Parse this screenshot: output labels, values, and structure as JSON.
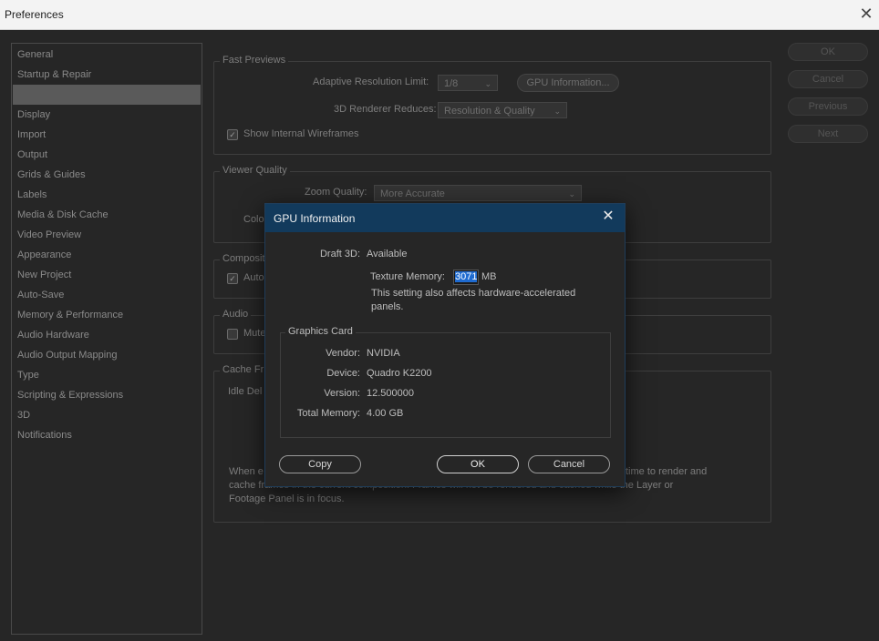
{
  "window": {
    "title": "Preferences"
  },
  "sidebar": {
    "items": [
      {
        "label": "General"
      },
      {
        "label": "Startup & Repair"
      },
      {
        "label": ""
      },
      {
        "label": "Display"
      },
      {
        "label": "Import"
      },
      {
        "label": "Output"
      },
      {
        "label": "Grids & Guides"
      },
      {
        "label": "Labels"
      },
      {
        "label": "Media & Disk Cache"
      },
      {
        "label": "Video Preview"
      },
      {
        "label": "Appearance"
      },
      {
        "label": "New Project"
      },
      {
        "label": "Auto-Save"
      },
      {
        "label": "Memory & Performance"
      },
      {
        "label": "Audio Hardware"
      },
      {
        "label": "Audio Output Mapping"
      },
      {
        "label": "Type"
      },
      {
        "label": "Scripting & Expressions"
      },
      {
        "label": "3D"
      },
      {
        "label": "Notifications"
      }
    ]
  },
  "right_buttons": {
    "ok": "OK",
    "cancel": "Cancel",
    "previous": "Previous",
    "next": "Next"
  },
  "fast_previews": {
    "title": "Fast Previews",
    "adaptive_label": "Adaptive Resolution Limit:",
    "adaptive_value": "1/8",
    "gpu_info_button": "GPU Information...",
    "renderer_label": "3D Renderer Reduces:",
    "renderer_value": "Resolution & Quality",
    "wireframes_label": "Show Internal Wireframes"
  },
  "viewer_quality": {
    "title": "Viewer Quality",
    "zoom_label": "Zoom Quality:",
    "zoom_value": "More Accurate",
    "color_label_partial": "Colo"
  },
  "composition": {
    "title_partial": "Composit",
    "checkbox_partial": "Auto"
  },
  "audio": {
    "title": "Audio",
    "checkbox_partial": "Mute"
  },
  "cache_frames": {
    "title_partial": "Cache Fr",
    "idle_partial": "Idle Del",
    "desc_left_partial": "When e",
    "desc_right_partial": "time to render and",
    "desc_line2_left": "cache frames in the current composition. Frames will not be rendered and cached while the Layer or",
    "desc_line3": "Footage Panel is in focus."
  },
  "gpu_dialog": {
    "title": "GPU Information",
    "draft3d_label": "Draft 3D:",
    "draft3d_value": "Available",
    "texture_label": "Texture Memory:",
    "texture_value": "3071",
    "texture_unit": "MB",
    "note_line1": "This setting also affects hardware-accelerated",
    "note_line2": "panels.",
    "graphics_card_title": "Graphics Card",
    "vendor_label": "Vendor:",
    "vendor_value": "NVIDIA",
    "device_label": "Device:",
    "device_value": "Quadro K2200",
    "version_label": "Version:",
    "version_value": "12.500000",
    "total_memory_label": "Total Memory:",
    "total_memory_value": "4.00 GB",
    "copy_button": "Copy",
    "ok_button": "OK",
    "cancel_button": "Cancel"
  }
}
